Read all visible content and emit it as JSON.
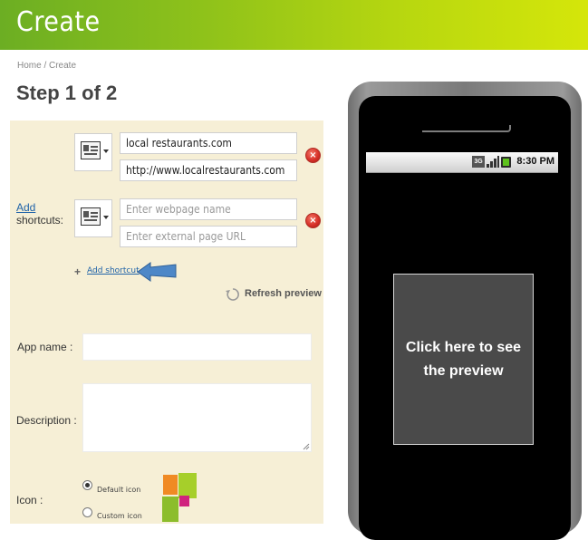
{
  "header": {
    "title": "Create"
  },
  "breadcrumb": {
    "text": "Home / Create"
  },
  "step": {
    "title": "Step 1 of 2"
  },
  "shortcuts": {
    "add_link": "Add",
    "label_suffix": "shortcuts:",
    "rows": [
      {
        "name_value": "local restaurants.com",
        "url_value": "http://www.localrestaurants.com",
        "name_placeholder": "",
        "url_placeholder": ""
      },
      {
        "name_value": "",
        "url_value": "",
        "name_placeholder": "Enter webpage name",
        "url_placeholder": "Enter external page URL"
      }
    ],
    "add_shortcut_label": "Add shortcut",
    "refresh_label": "Refresh preview"
  },
  "form": {
    "app_name_label": "App name :",
    "description_label": "Description :",
    "icon_label": "Icon :",
    "icon_options": [
      "Default icon",
      "Custom icon"
    ],
    "icon_selected": "Default icon"
  },
  "phone": {
    "time": "8:30 PM",
    "network": "3G",
    "preview_text": "Click here to see the preview"
  },
  "colors": {
    "header_start": "#6cae23",
    "header_end": "#d5e60a",
    "panel": "#f6efd6",
    "link": "#1e62a8",
    "remove": "#d8322a"
  }
}
